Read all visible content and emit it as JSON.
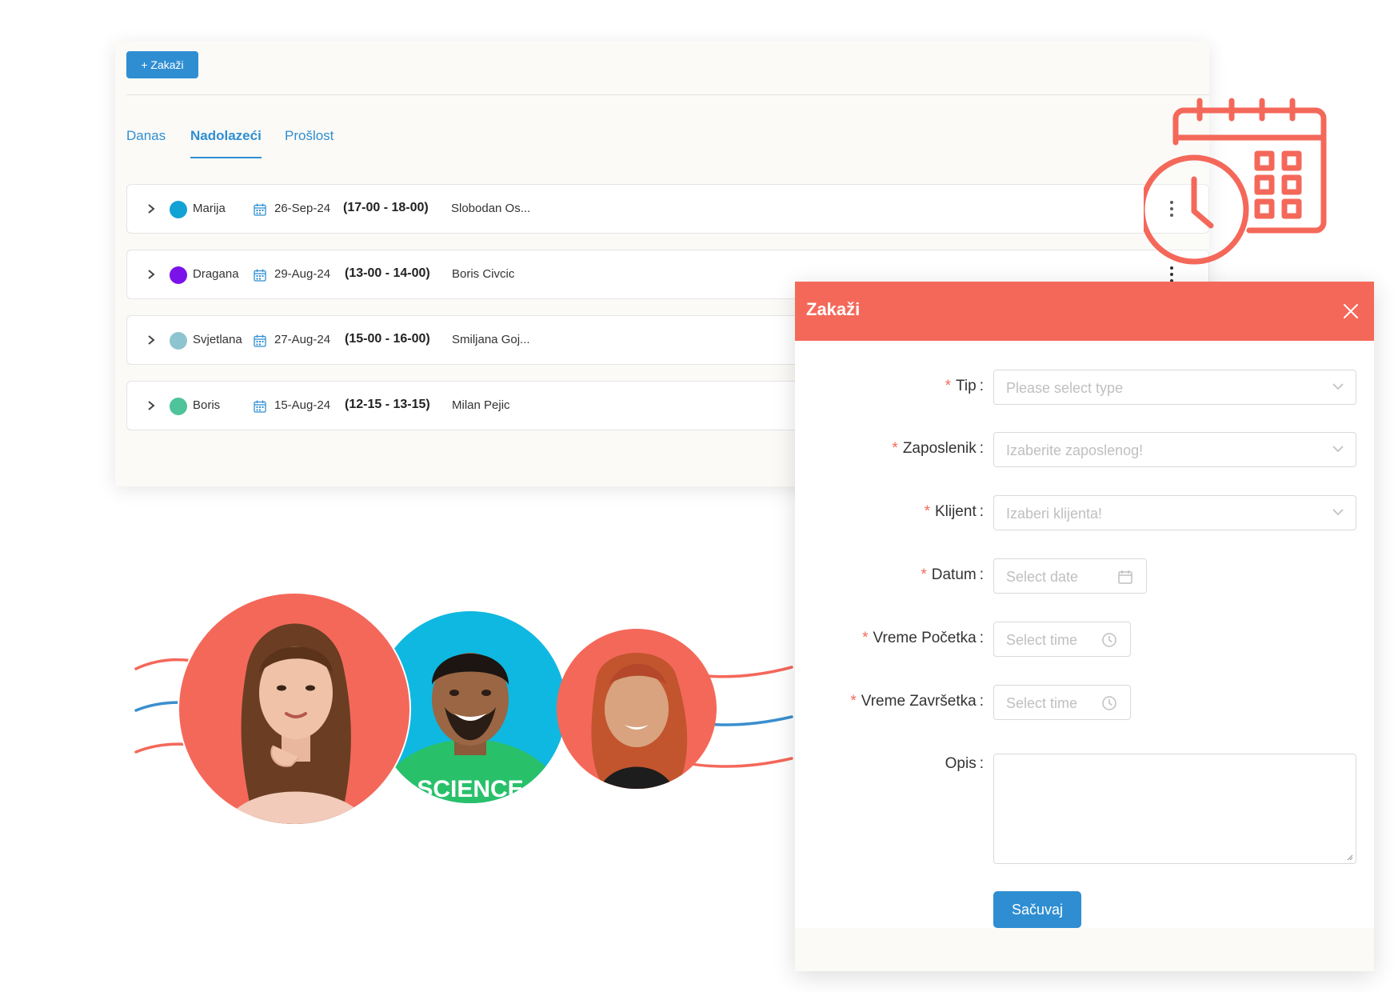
{
  "toolbar": {
    "add_label": "+ Zakaži"
  },
  "tabs": [
    {
      "label": "Danas",
      "active": false
    },
    {
      "label": "Nadolazeći",
      "active": true
    },
    {
      "label": "Prošlost",
      "active": false
    }
  ],
  "appointments": [
    {
      "client": "Marija",
      "color": "#12a3d4",
      "date": "26-Sep-24",
      "time": "(17-00 - 18-00)",
      "employee": "Slobodan Os..."
    },
    {
      "client": "Dragana",
      "color": "#7b12ea",
      "date": "29-Aug-24",
      "time": "(13-00 - 14-00)",
      "employee": "Boris Civcic"
    },
    {
      "client": "Svjetlana",
      "color": "#8ec4cf",
      "date": "27-Aug-24",
      "time": "(15-00 - 16-00)",
      "employee": "Smiljana Goj..."
    },
    {
      "client": "Boris",
      "color": "#4fc39a",
      "date": "15-Aug-24",
      "time": "(12-15 - 13-15)",
      "employee": "Milan Pejic"
    }
  ],
  "icons": {
    "expand": "chevron-right-icon",
    "date": "calendar-icon",
    "menu": "more-vertical-icon",
    "decoration": "calendar-clock-icon",
    "close": "close-icon",
    "select": "chevron-down-icon",
    "time": "clock-icon"
  },
  "modal": {
    "title": "Zakaži",
    "fields": {
      "tip": {
        "label": "Tip",
        "placeholder": "Please select type"
      },
      "zaposlenik": {
        "label": "Zaposlenik",
        "placeholder": "Izaberite zaposlenog!"
      },
      "klijent": {
        "label": "Klijent",
        "placeholder": "Izaberi klijenta!"
      },
      "datum": {
        "label": "Datum",
        "placeholder": "Select date"
      },
      "vreme_pocetka": {
        "label": "Vreme Početka",
        "placeholder": "Select time"
      },
      "vreme_zavrsetka": {
        "label": "Vreme Završetka",
        "placeholder": "Select time"
      },
      "opis": {
        "label": "Opis"
      }
    },
    "required_mark": "*",
    "colon": ":",
    "save_label": "Sačuvaj"
  },
  "colors": {
    "accent": "#2f8ed2",
    "brand_coral": "#f4685a",
    "wave_blue": "#3a8fce",
    "avatar_blue_bg": "#0fb8e0"
  }
}
